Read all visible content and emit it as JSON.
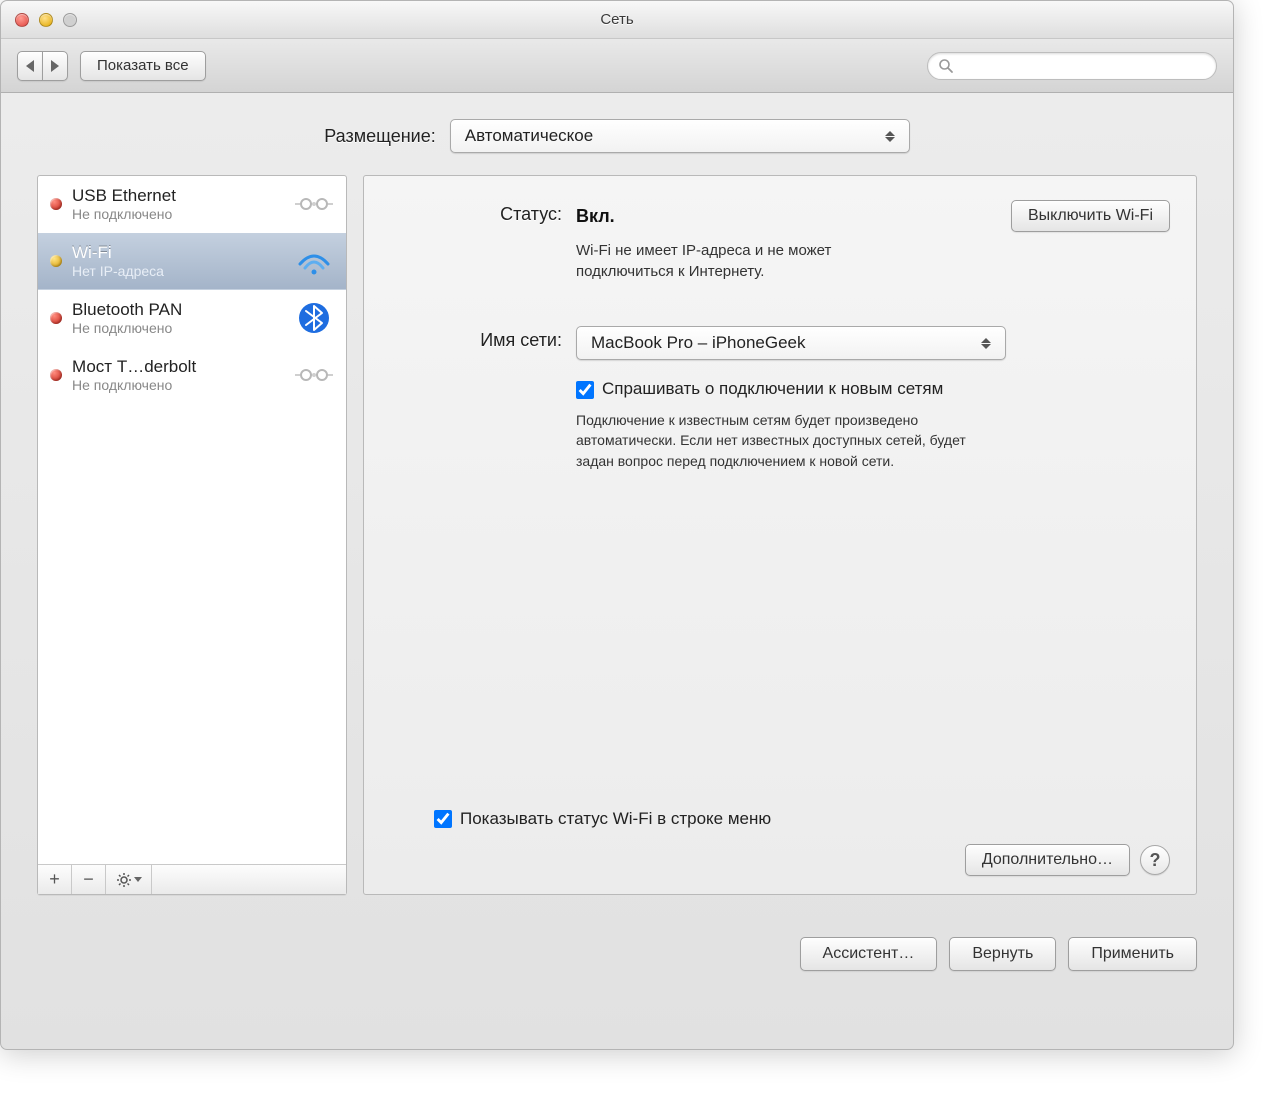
{
  "window_title": "Сеть",
  "toolbar": {
    "show_all": "Показать все"
  },
  "location": {
    "label": "Размещение:",
    "value": "Автоматическое"
  },
  "sidebar": {
    "items": [
      {
        "name": "USB Ethernet",
        "status": "Не подключено",
        "dot": "red",
        "icon": "ethernet",
        "selected": false
      },
      {
        "name": "Wi-Fi",
        "status": "Нет IP-адреса",
        "dot": "yellow",
        "icon": "wifi",
        "selected": true
      },
      {
        "name": "Bluetooth PAN",
        "status": "Не подключено",
        "dot": "red",
        "icon": "bluetooth",
        "selected": false
      },
      {
        "name": "Мост T…derbolt",
        "status": "Не подключено",
        "dot": "red",
        "icon": "ethernet",
        "selected": false
      }
    ]
  },
  "detail": {
    "status_label": "Статус:",
    "status_value": "Вкл.",
    "toggle_wifi": "Выключить Wi-Fi",
    "status_desc": "Wi-Fi не имеет IP-адреса и не может\nподключиться к Интернету.",
    "network_label": "Имя сети:",
    "network_value": "MacBook Pro – iPhoneGeek",
    "ask_new_label": "Спрашивать о подключении к новым сетям",
    "ask_new_desc": "Подключение к известным сетям будет произведено автоматически. Если нет известных доступных сетей, будет задан вопрос перед подключением к новой сети.",
    "show_menubar": "Показывать статус Wi-Fi в строке меню",
    "advanced": "Дополнительно…"
  },
  "footer": {
    "assist": "Ассистент…",
    "revert": "Вернуть",
    "apply": "Применить"
  }
}
